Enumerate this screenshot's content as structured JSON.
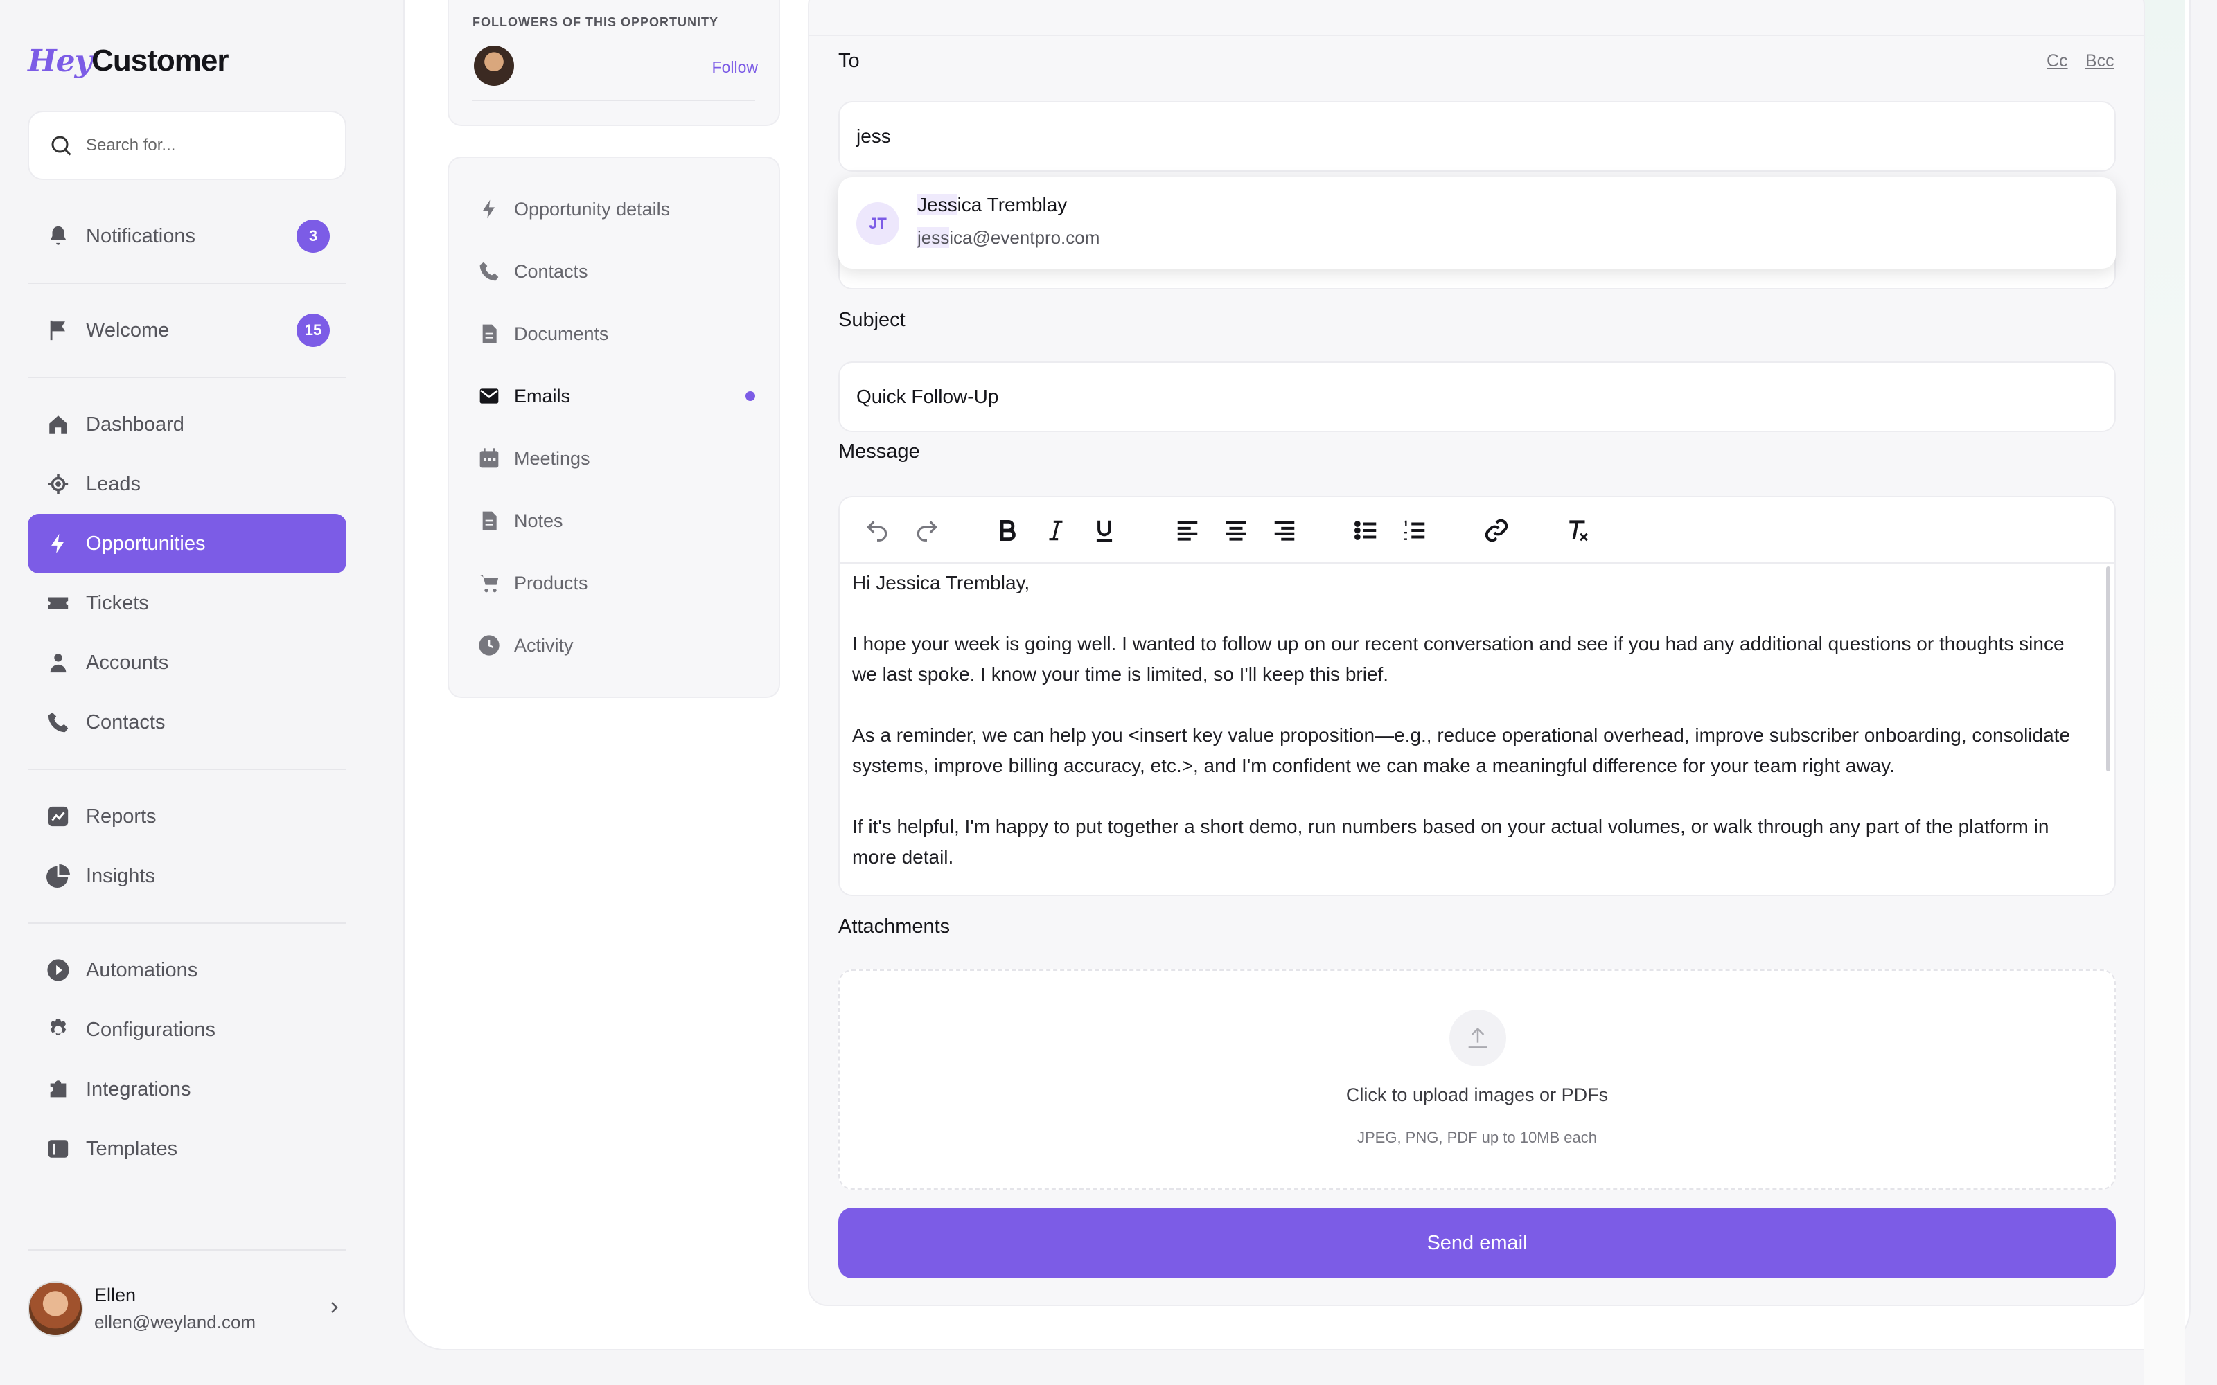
{
  "sidebar": {
    "logo_part1": "Hey",
    "logo_part2": "Customer",
    "search_placeholder": "Search for...",
    "top_items": [
      {
        "label": "Notifications",
        "badge": "3",
        "icon": "bell-icon"
      },
      {
        "label": "Welcome",
        "badge": "15",
        "icon": "flag-icon"
      }
    ],
    "items": [
      {
        "label": "Dashboard",
        "icon": "home-icon"
      },
      {
        "label": "Leads",
        "icon": "target-icon"
      },
      {
        "label": "Opportunities",
        "icon": "bolt-icon"
      },
      {
        "label": "Tickets",
        "icon": "ticket-icon"
      },
      {
        "label": "Accounts",
        "icon": "person-icon"
      },
      {
        "label": "Contacts",
        "icon": "phone-icon"
      },
      {
        "label": "Reports",
        "icon": "chart-icon"
      },
      {
        "label": "Insights",
        "icon": "pie-icon"
      },
      {
        "label": "Automations",
        "icon": "play-icon"
      },
      {
        "label": "Configurations",
        "icon": "gear-icon"
      },
      {
        "label": "Integrations",
        "icon": "puzzle-icon"
      },
      {
        "label": "Templates",
        "icon": "layout-icon"
      }
    ],
    "active": "Opportunities",
    "user": {
      "name": "Ellen",
      "email": "ellen@weyland.com"
    }
  },
  "followers": {
    "label": "FOLLOWERS OF THIS OPPORTUNITY",
    "follow": "Follow"
  },
  "subnav": {
    "items": [
      {
        "label": "Opportunity details",
        "icon": "bolt-icon"
      },
      {
        "label": "Contacts",
        "icon": "phone-icon"
      },
      {
        "label": "Documents",
        "icon": "document-icon"
      },
      {
        "label": "Emails",
        "icon": "mail-icon"
      },
      {
        "label": "Meetings",
        "icon": "calendar-icon"
      },
      {
        "label": "Notes",
        "icon": "note-icon"
      },
      {
        "label": "Products",
        "icon": "cart-icon"
      },
      {
        "label": "Activity",
        "icon": "clock-icon"
      }
    ],
    "active": "Emails"
  },
  "email": {
    "to_label": "To",
    "cc": "Cc",
    "bcc": "Bcc",
    "to_value": "jess",
    "suggestion": {
      "initials": "JT",
      "name_match": "Jess",
      "name_rest": "ica Tremblay",
      "email_match": "jess",
      "email_rest": "ica@eventpro.com"
    },
    "subject_label": "Subject",
    "subject_value": "Quick Follow-Up",
    "message_label": "Message",
    "body": [
      "Hi Jessica Tremblay,",
      "I hope your week is going well. I wanted to follow up on our recent conversation and see if you had any additional questions or thoughts since we last spoke. I know your time is limited, so I'll keep this brief.",
      "As a reminder, we can help you <insert key value proposition—e.g., reduce operational overhead, improve subscriber onboarding, consolidate systems, improve billing accuracy, etc.>, and I'm confident we can make a meaningful difference for your team right away.",
      "If it's helpful, I'm happy to put together a short demo, run numbers based on your actual volumes, or walk through any part of the platform in more detail."
    ],
    "attachments_label": "Attachments",
    "upload_main": "Click to upload images or PDFs",
    "upload_sub": "JPEG, PNG, PDF up to 10MB each",
    "send": "Send email"
  },
  "colors": {
    "accent": "#7c5ce6",
    "text": "#15151a",
    "muted": "#55555c"
  }
}
